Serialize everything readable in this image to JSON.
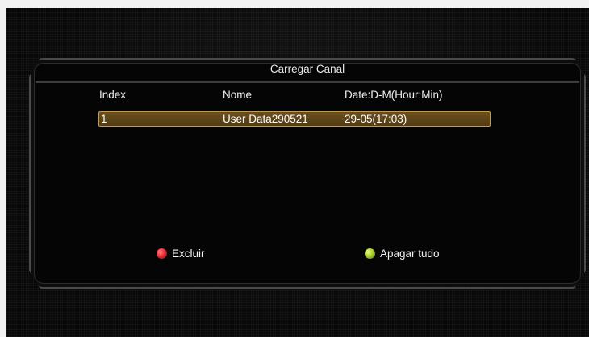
{
  "dialog": {
    "title": "Carregar Canal"
  },
  "table": {
    "headers": [
      "Index",
      "Nome",
      "Date:D-M(Hour:Min)"
    ],
    "rows": [
      {
        "index": "1",
        "name": "User Data290521",
        "date": "29-05(17:03)",
        "selected": true
      }
    ]
  },
  "actions": {
    "red": {
      "label": "Excluir",
      "color": "#e0202a"
    },
    "green": {
      "label": "Apagar tudo",
      "color": "#9bc41c"
    }
  },
  "colors": {
    "selection_border": "#c79a4a",
    "selection_fill": "#5e451a",
    "background": "#070707"
  }
}
